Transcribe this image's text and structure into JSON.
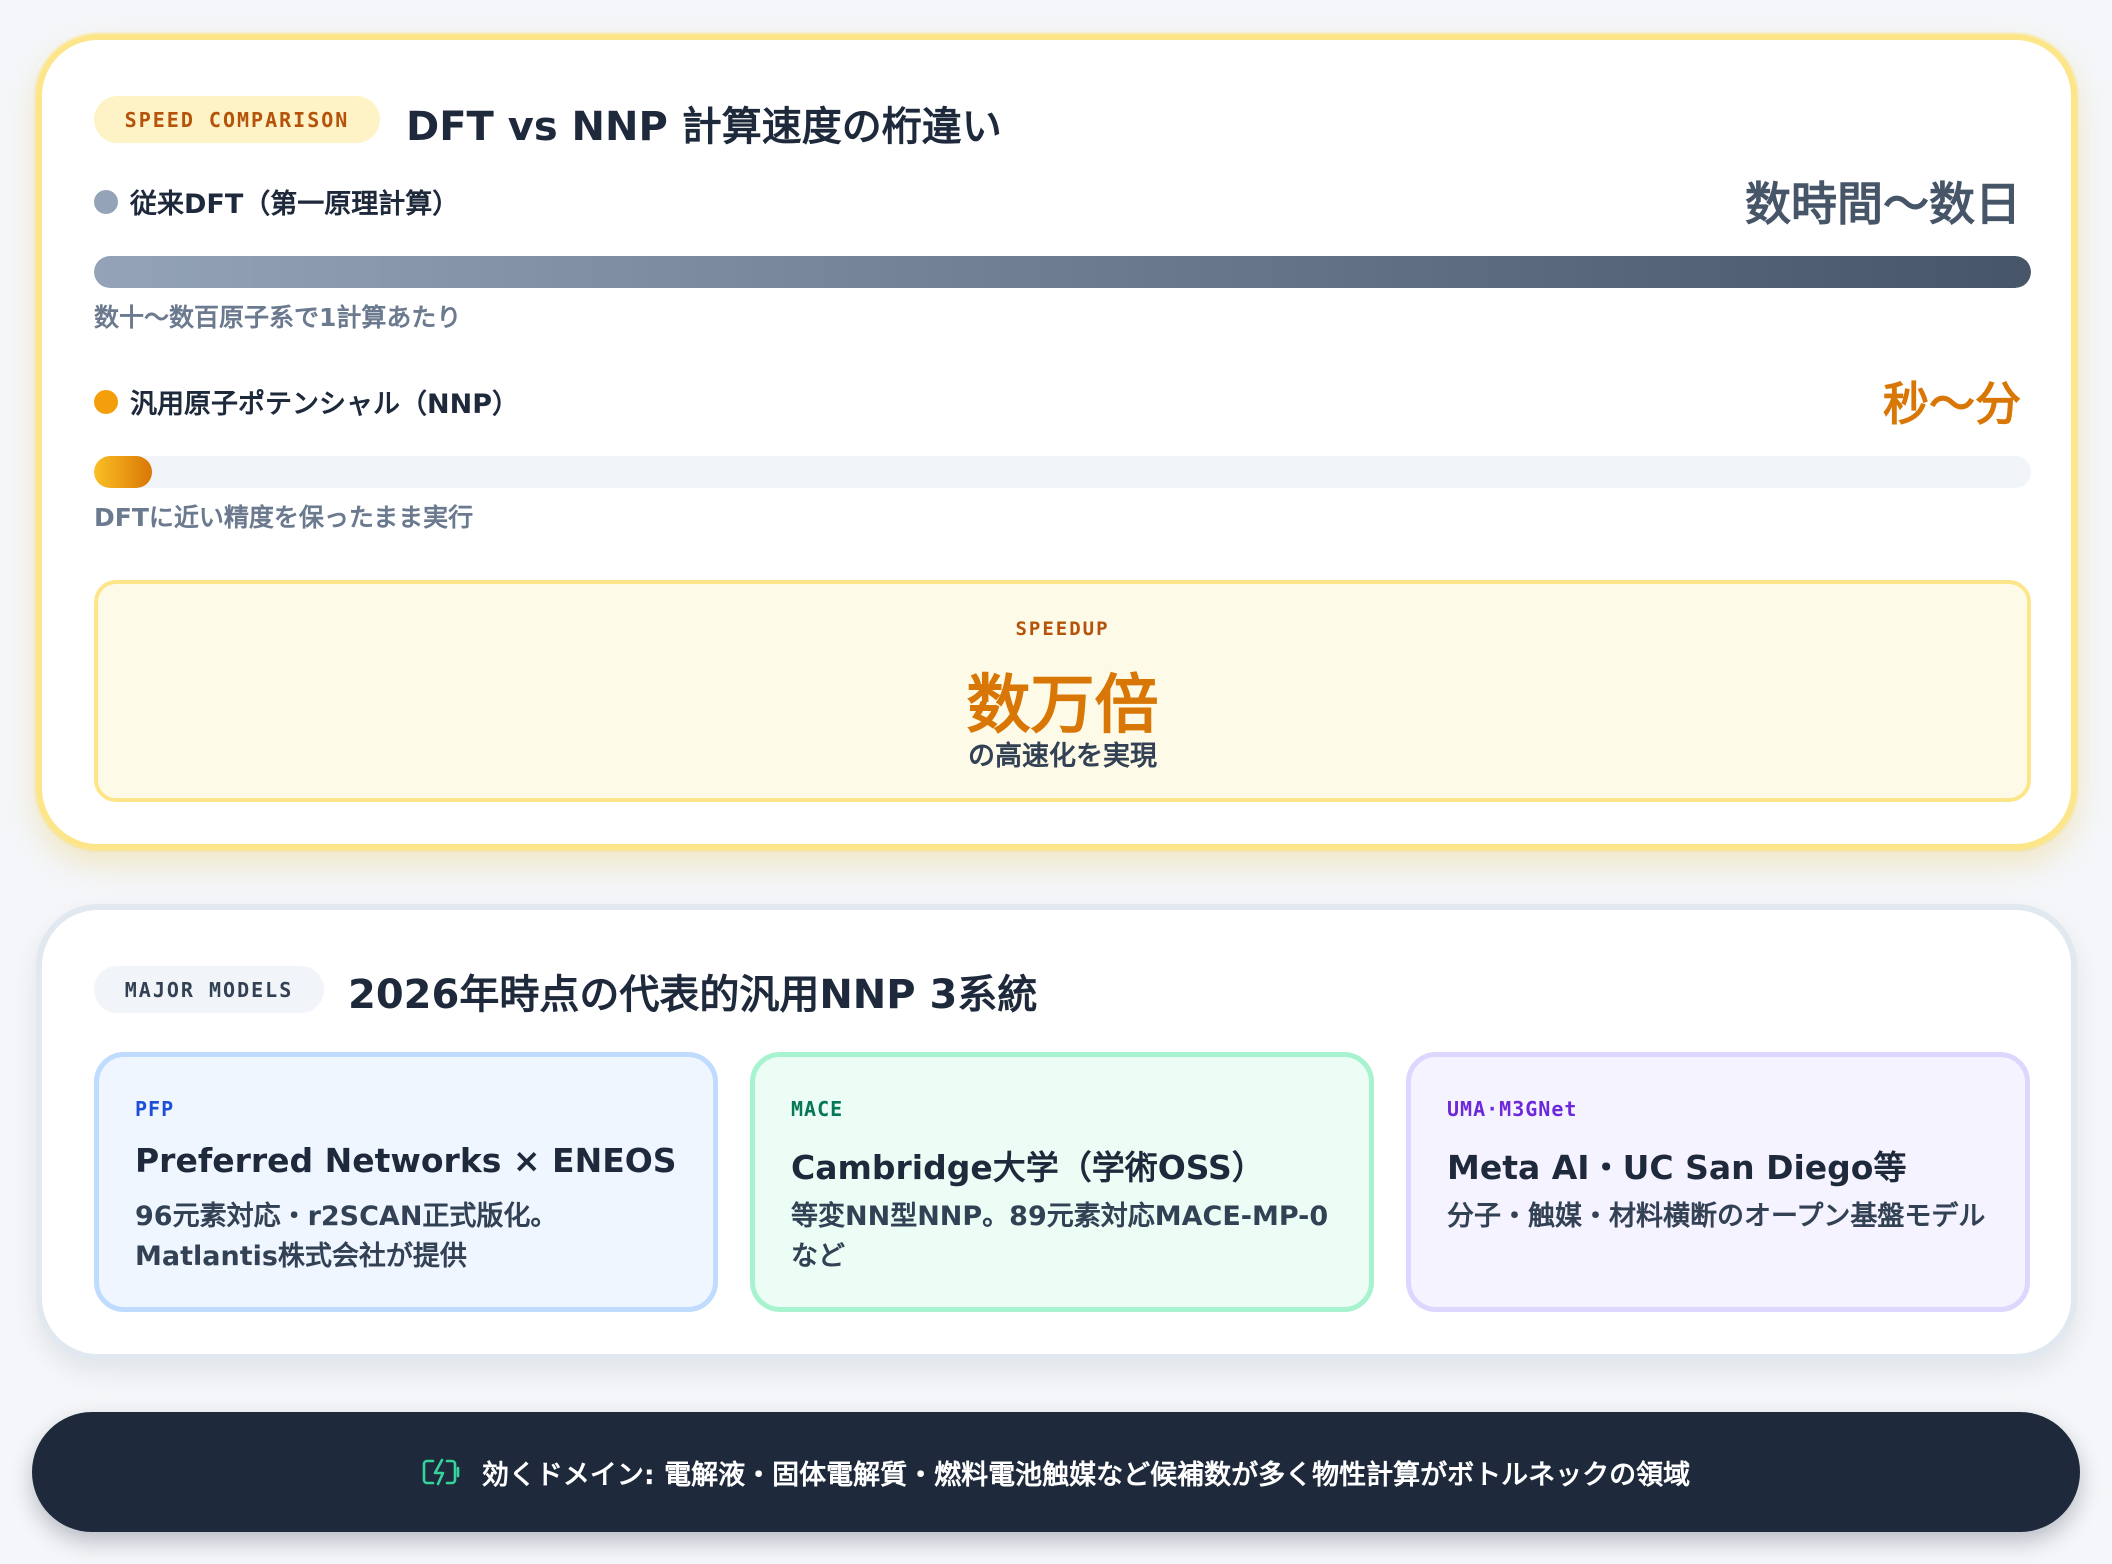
{
  "speed_comparison": {
    "tag": "SPEED COMPARISON",
    "title": "DFT vs NNP 計算速度の桁違い",
    "rows": [
      {
        "label": "従来DFT（第一原理計算）",
        "value": "数時間〜数日",
        "sub": "数十〜数百原子系で1計算あたり",
        "bar_fill_percent": 100,
        "dot_color": "#94a3b8",
        "value_color": "#475569"
      },
      {
        "label": "汎用原子ポテンシャル（NNP）",
        "value": "秒〜分",
        "sub": "DFTに近い精度を保ったまま実行",
        "bar_fill_percent": 3,
        "dot_color": "#f59e0b",
        "value_color": "#d97706"
      }
    ],
    "speedup": {
      "label": "SPEEDUP",
      "value": "数万倍",
      "caption": "の高速化を実現"
    }
  },
  "major_models": {
    "tag": "MAJOR MODELS",
    "title": "2026年時点の代表的汎用NNP 3系統",
    "models": [
      {
        "tag": "PFP",
        "name": "Preferred Networks × ENEOS",
        "desc": "96元素対応・r2SCAN正式版化。Matlantis株式会社が提供"
      },
      {
        "tag": "MACE",
        "name": "Cambridge大学（学術OSS）",
        "desc": "等変NN型NNP。89元素対応MACE-MP-0など"
      },
      {
        "tag": "UMA·M3GNet",
        "name": "Meta AI・UC San Diego等",
        "desc": "分子・触媒・材料横断のオープン基盤モデル"
      }
    ]
  },
  "footer": {
    "icon": "battery-charging-icon",
    "text": "効くドメイン: 電解液・固体電解質・燃料電池触媒など候補数が多く物性計算がボトルネックの領域"
  },
  "colors": {
    "accent_amber": "#d97706",
    "footer_bg": "#1e293b",
    "icon_green": "#34d399"
  }
}
